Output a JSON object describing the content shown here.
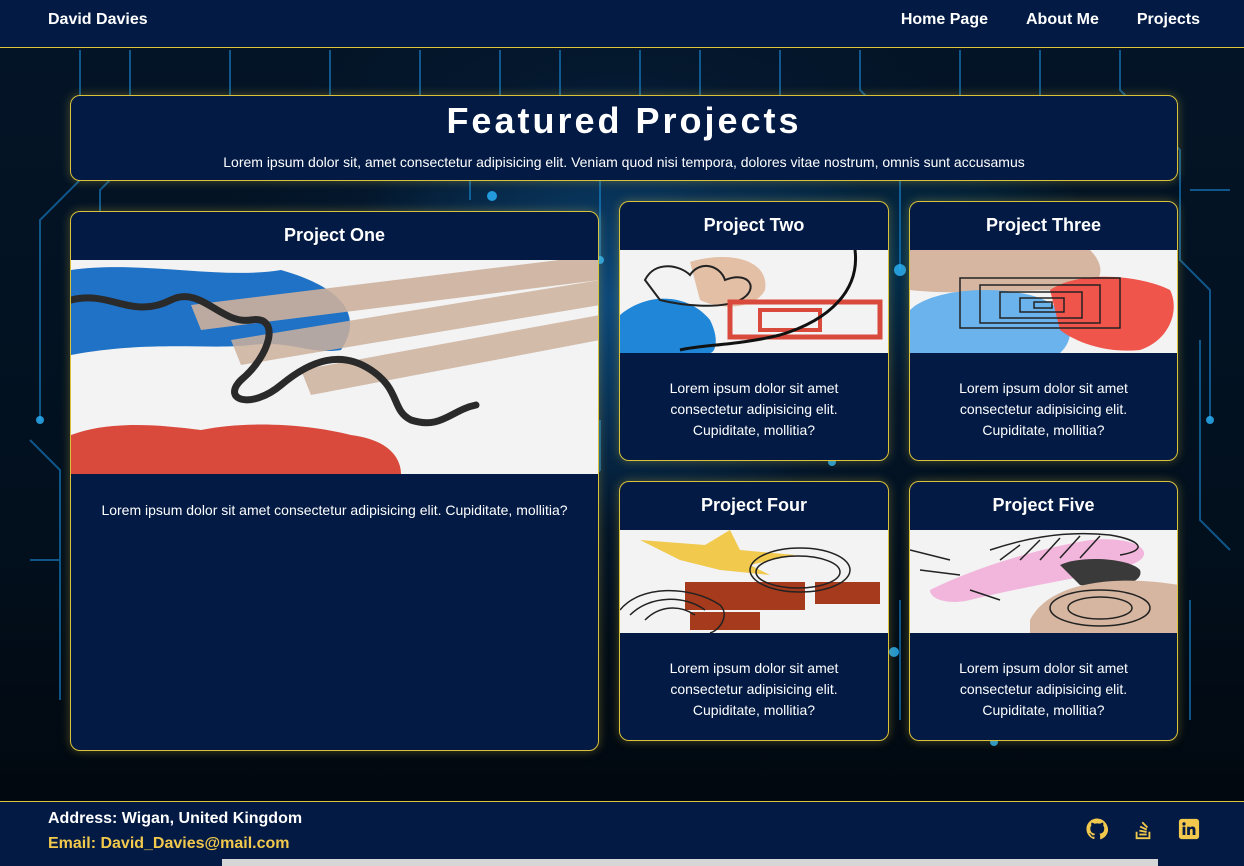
{
  "header": {
    "brand": "David Davies",
    "nav": [
      "Home Page",
      "About Me",
      "Projects"
    ]
  },
  "hero": {
    "title": "Featured Projects",
    "subtitle": "Lorem ipsum dolor sit, amet consectetur adipisicing elit. Veniam quod nisi tempora, dolores vitae nostrum, omnis sunt accusamus"
  },
  "projects": [
    {
      "title": "Project One",
      "description": "Lorem ipsum dolor sit amet consectetur adipisicing elit. Cupiditate, mollitia?"
    },
    {
      "title": "Project Two",
      "description": "Lorem ipsum dolor sit amet consectetur adipisicing elit. Cupiditate, mollitia?"
    },
    {
      "title": "Project Three",
      "description": "Lorem ipsum dolor sit amet consectetur adipisicing elit. Cupiditate, mollitia?"
    },
    {
      "title": "Project Four",
      "description": "Lorem ipsum dolor sit amet consectetur adipisicing elit. Cupiditate, mollitia?"
    },
    {
      "title": "Project Five",
      "description": "Lorem ipsum dolor sit amet consectetur adipisicing elit. Cupiditate, mollitia?"
    }
  ],
  "footer": {
    "address": "Address: Wigan, United Kingdom",
    "email": "Email: David_Davies@mail.com",
    "socials": [
      "github-icon",
      "stackoverflow-icon",
      "linkedin-icon"
    ]
  },
  "colors": {
    "navy": "#021a44",
    "accent_border": "#d9c13a",
    "email_yellow": "#f2c94c"
  }
}
